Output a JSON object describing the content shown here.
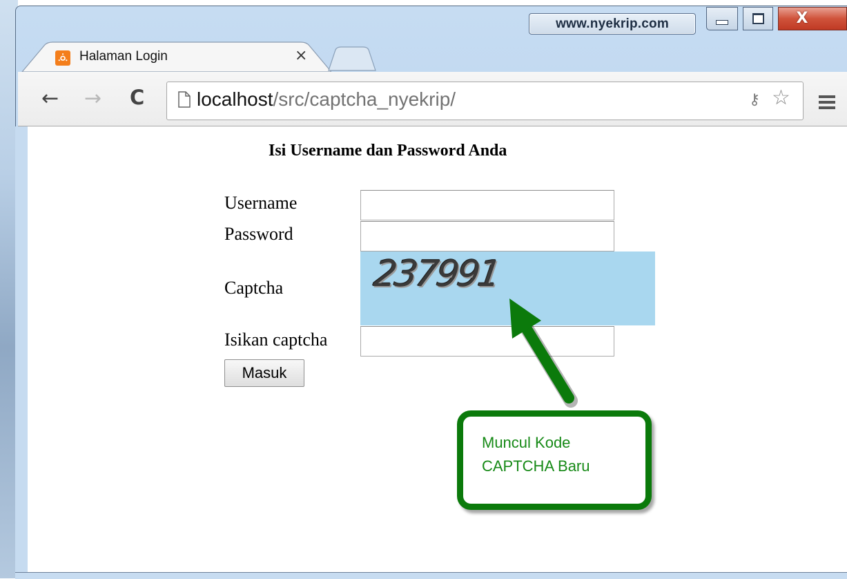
{
  "window": {
    "watermark": "www.nyekrip.com",
    "close_glyph": "X"
  },
  "tab": {
    "title": "Halaman Login",
    "favicon_glyph": "ꗝ",
    "close_glyph": "×"
  },
  "toolbar": {
    "back_glyph": "←",
    "forward_glyph": "→",
    "reload_glyph": "C",
    "url_host": "localhost",
    "url_path": "/src/captcha_nyekrip/",
    "key_glyph": "⚷",
    "star_glyph": "☆"
  },
  "form": {
    "heading": "Isi Username dan Password Anda",
    "username_label": "Username",
    "password_label": "Password",
    "captcha_label": "Captcha",
    "captcha_code": "237991",
    "captcha_input_label": "Isikan captcha",
    "username_value": "",
    "password_value": "",
    "captcha_input_value": "",
    "submit_label": "Masuk"
  },
  "annotation": {
    "text": "Muncul Kode\nCAPTCHA Baru",
    "color": "#0b7a0b"
  },
  "colors": {
    "captcha_bg": "#a9d7ef",
    "favicon": "#f47e1b",
    "close_button": "#c03a24"
  }
}
